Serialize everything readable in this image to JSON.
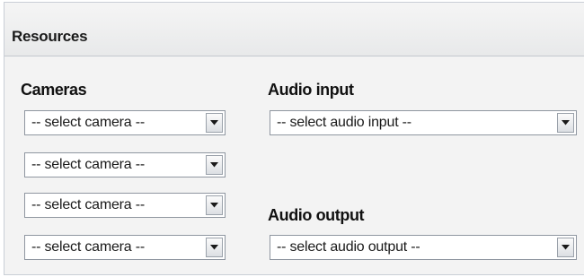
{
  "panel": {
    "title": "Resources"
  },
  "cameras": {
    "label": "Cameras",
    "selects": [
      {
        "value": "-- select camera --"
      },
      {
        "value": "-- select camera --"
      },
      {
        "value": "-- select camera --"
      },
      {
        "value": "-- select camera --"
      }
    ]
  },
  "audio_input": {
    "label": "Audio input",
    "value": "-- select audio input --"
  },
  "audio_output": {
    "label": "Audio output",
    "value": "-- select audio output --"
  },
  "icons": {
    "dropdown": "chevron-down-icon"
  }
}
